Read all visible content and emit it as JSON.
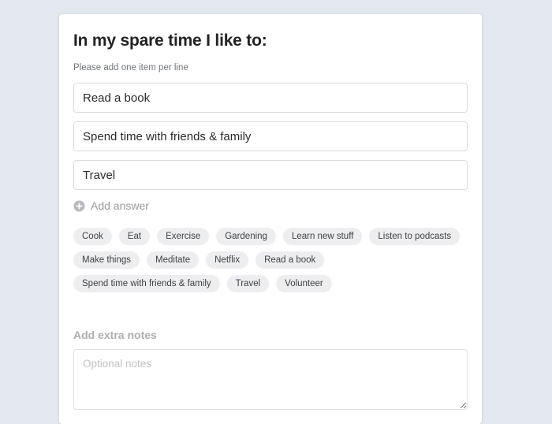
{
  "form": {
    "title": "In my spare time I like to:",
    "subtitle": "Please add one item per line",
    "answers": [
      {
        "value": "Read a book",
        "placeholder": ""
      },
      {
        "value": "Spend time with friends & family",
        "placeholder": ""
      },
      {
        "value": "Travel",
        "placeholder": ""
      }
    ],
    "add_answer": {
      "label": "Add answer",
      "icon": "plus-circle-icon"
    },
    "suggestions": [
      "Cook",
      "Eat",
      "Exercise",
      "Gardening",
      "Learn new stuff",
      "Listen to podcasts",
      "Make things",
      "Meditate",
      "Netflix",
      "Read a book",
      "Spend time with friends & family",
      "Travel",
      "Volunteer"
    ],
    "notes": {
      "label": "Add extra notes",
      "value": "",
      "placeholder": "Optional notes"
    }
  },
  "colors": {
    "page_background": "#e3e7ee",
    "card_background": "#ffffff",
    "title_text": "#232323",
    "muted_text": "#9a9a9e",
    "chip_background": "#eeeef0",
    "chip_text": "#3f4246",
    "input_border": "#dcdcdc"
  }
}
